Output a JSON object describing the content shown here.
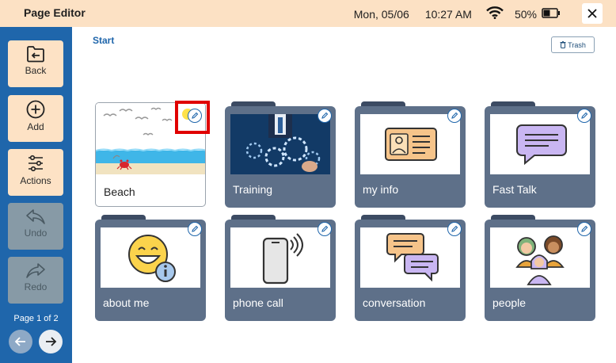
{
  "header": {
    "title": "Page Editor",
    "date": "Mon, 05/06",
    "time": "10:27 AM",
    "battery": "50%",
    "battery_level": 0.5,
    "icons": [
      "wifi-icon",
      "battery-icon",
      "close-icon"
    ]
  },
  "sidebar": {
    "back": "Back",
    "add": "Add",
    "actions": "Actions",
    "undo": "Undo",
    "redo": "Redo",
    "page_info": "Page 1 of 2"
  },
  "breadcrumb": "Start",
  "trash_label": "Trash",
  "tiles": [
    {
      "label": "Beach",
      "type": "page"
    },
    {
      "label": "Training",
      "type": "folder"
    },
    {
      "label": "my info",
      "type": "folder"
    },
    {
      "label": "Fast Talk",
      "type": "folder"
    },
    {
      "label": "about me",
      "type": "folder"
    },
    {
      "label": "phone call",
      "type": "folder"
    },
    {
      "label": "conversation",
      "type": "folder"
    },
    {
      "label": "people",
      "type": "folder"
    }
  ],
  "colors": {
    "header_bg": "#fce1c4",
    "sidebar_bg": "#1f66ab",
    "folder": "#5e7089",
    "highlight": "#e00000"
  }
}
